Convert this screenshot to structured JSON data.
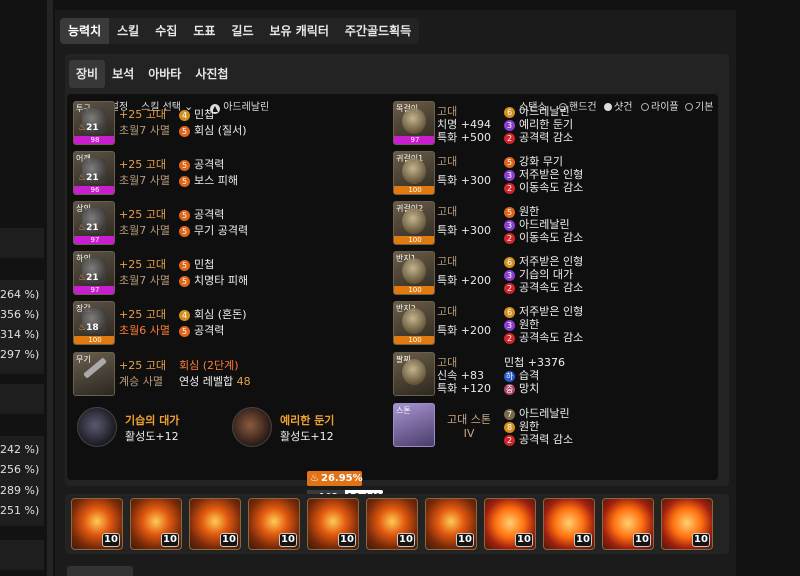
{
  "left_pcts": [
    "264 %)",
    "356 %)",
    "314 %)",
    "297 %)",
    "242 %)",
    "256 %)",
    "289 %)",
    "251 %)"
  ],
  "tabs": [
    {
      "label": "능력치",
      "active": true
    },
    {
      "label": "스킬"
    },
    {
      "label": "수집"
    },
    {
      "label": "도표"
    },
    {
      "label": "길드"
    },
    {
      "label": "보유 캐릭터"
    },
    {
      "label": "주간골드획득"
    }
  ],
  "subtabs": [
    {
      "label": "장비",
      "active": true
    },
    {
      "label": "보석"
    },
    {
      "label": "아바타"
    },
    {
      "label": "사진첩"
    }
  ],
  "toolbar": {
    "effect_settings": "효과 설정",
    "skill_select": "스킬 선택",
    "adrenaline": "아드레날린",
    "stance_label": "스탠스",
    "stances": [
      "핸드건",
      "샷건",
      "라이플",
      "기본"
    ],
    "selected_stance": "샷건"
  },
  "equipment": [
    {
      "slot": "투구",
      "level": "21",
      "quality": "98",
      "refine": "+25 고대",
      "tier": "초월7 사멸",
      "e1_num": "4",
      "e1": "민첩",
      "e2_num": "5",
      "e2": "회심 (질서)"
    },
    {
      "slot": "어깨",
      "level": "21",
      "quality": "96",
      "refine": "+25 고대",
      "tier": "초월7 사멸",
      "e1_num": "5",
      "e1": "공격력",
      "e2_num": "5",
      "e2": "보스 피해"
    },
    {
      "slot": "상의",
      "level": "21",
      "quality": "97",
      "refine": "+25 고대",
      "tier": "초월7 사멸",
      "e1_num": "5",
      "e1": "공격력",
      "e2_num": "5",
      "e2": "무기 공격력"
    },
    {
      "slot": "하의",
      "level": "21",
      "quality": "97",
      "refine": "+25 고대",
      "tier": "초월7 사멸",
      "e1_num": "5",
      "e1": "민첩",
      "e2_num": "5",
      "e2": "치명타 피해"
    },
    {
      "slot": "장갑",
      "level": "18",
      "quality": "100",
      "refine": "+25 고대",
      "tier": "초월6 사멸",
      "e1_num": "4",
      "e1": "회심 (혼돈)",
      "e2_num": "5",
      "e2": "공격력"
    }
  ],
  "weapon": {
    "slot": "무기",
    "refine": "+25 고대",
    "tier": "계승 사멸",
    "elixir_text": "회심 (2단계)",
    "link_label": "연성 레벨합",
    "link_value": "48",
    "elixir_pct": "26.95%",
    "trans_level": "102",
    "trans_pct": "16.44%"
  },
  "engravings": [
    {
      "name": "기습의 대가",
      "value": "활성도+12"
    },
    {
      "name": "예리한 둔기",
      "value": "활성도+12"
    }
  ],
  "accessories": [
    {
      "slot": "목걸이",
      "quality": "97",
      "grade": "고대",
      "stats": [
        "치명 +494",
        "특화 +500"
      ],
      "eng": [
        {
          "n": "6",
          "c": "g",
          "t": "아드레날린"
        },
        {
          "n": "3",
          "c": "p",
          "t": "예리한 둔기"
        },
        {
          "n": "2",
          "c": "r",
          "t": "공격력 감소"
        }
      ]
    },
    {
      "slot": "귀걸이1",
      "quality": "100",
      "grade": "고대",
      "stats": [
        "특화 +300"
      ],
      "eng": [
        {
          "n": "5",
          "c": "o",
          "t": "강화 무기"
        },
        {
          "n": "3",
          "c": "p",
          "t": "저주받은 인형"
        },
        {
          "n": "2",
          "c": "r",
          "t": "이동속도 감소"
        }
      ]
    },
    {
      "slot": "귀걸이2",
      "quality": "100",
      "grade": "고대",
      "stats": [
        "특화 +300"
      ],
      "eng": [
        {
          "n": "5",
          "c": "o",
          "t": "원한"
        },
        {
          "n": "3",
          "c": "p",
          "t": "아드레날린"
        },
        {
          "n": "2",
          "c": "r",
          "t": "이동속도 감소"
        }
      ]
    },
    {
      "slot": "반지1",
      "quality": "100",
      "grade": "고대",
      "stats": [
        "특화 +200"
      ],
      "eng": [
        {
          "n": "6",
          "c": "g",
          "t": "저주받은 인형"
        },
        {
          "n": "3",
          "c": "p",
          "t": "기습의 대가"
        },
        {
          "n": "2",
          "c": "r",
          "t": "공격속도 감소"
        }
      ]
    },
    {
      "slot": "반지2",
      "quality": "100",
      "grade": "고대",
      "stats": [
        "특화 +200"
      ],
      "eng": [
        {
          "n": "6",
          "c": "g",
          "t": "저주받은 인형"
        },
        {
          "n": "3",
          "c": "p",
          "t": "원한"
        },
        {
          "n": "2",
          "c": "r",
          "t": "공격속도 감소"
        }
      ]
    },
    {
      "slot": "팔찌",
      "quality": "",
      "grade": "고대",
      "stats": [
        "신속 +83",
        "특화 +120"
      ],
      "eng": [
        {
          "n": "",
          "c": "",
          "t": "민첩 +3376"
        },
        {
          "n": "하",
          "c": "b",
          "t": "습격"
        },
        {
          "n": "중",
          "c": "t",
          "t": "망치"
        }
      ]
    }
  ],
  "stone": {
    "slot": "스톤",
    "name": "고대 스톤 IV",
    "eng": [
      {
        "n": "7",
        "c": "g",
        "t": "아드레날린"
      },
      {
        "n": "8",
        "c": "g",
        "t": "원한"
      },
      {
        "n": "2",
        "c": "r",
        "t": "공격력 감소"
      }
    ]
  },
  "gems": [
    {
      "level": "10",
      "type": "annihilation"
    },
    {
      "level": "10",
      "type": "annihilation"
    },
    {
      "level": "10",
      "type": "annihilation"
    },
    {
      "level": "10",
      "type": "annihilation"
    },
    {
      "level": "10",
      "type": "annihilation"
    },
    {
      "level": "10",
      "type": "annihilation"
    },
    {
      "level": "10",
      "type": "annihilation"
    },
    {
      "level": "10",
      "type": "crimson"
    },
    {
      "level": "10",
      "type": "crimson"
    },
    {
      "level": "10",
      "type": "crimson"
    },
    {
      "level": "10",
      "type": "crimson"
    }
  ]
}
